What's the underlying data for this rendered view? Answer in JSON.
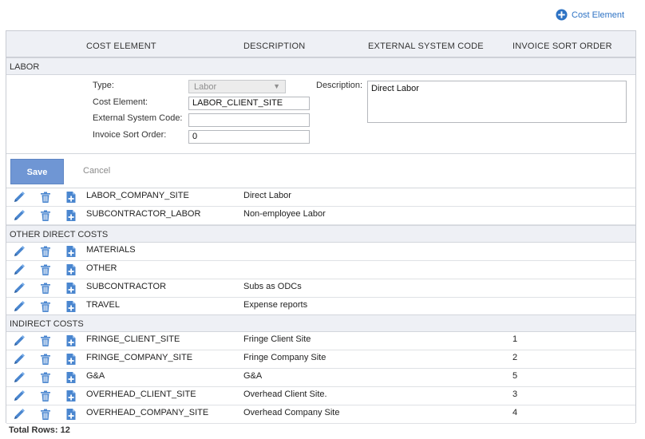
{
  "toolbar": {
    "add_label": "Cost Element"
  },
  "columns": {
    "cost_element": "COST ELEMENT",
    "description": "DESCRIPTION",
    "external_code": "EXTERNAL SYSTEM CODE",
    "sort_order": "INVOICE SORT ORDER"
  },
  "groups": {
    "labor": "LABOR",
    "odc": "OTHER DIRECT COSTS",
    "indirect": "INDIRECT COSTS"
  },
  "editor": {
    "type_label": "Type:",
    "type_value": "Labor",
    "cost_element_label": "Cost Element:",
    "cost_element_value": "LABOR_CLIENT_SITE",
    "external_label": "External System Code:",
    "external_value": "",
    "sort_label": "Invoice Sort Order:",
    "sort_value": "0",
    "description_label": "Description:",
    "description_value": "Direct Labor",
    "save_label": "Save",
    "cancel_label": "Cancel"
  },
  "labor_rows": [
    {
      "name": "LABOR_COMPANY_SITE",
      "description": "Direct Labor",
      "code": "",
      "sort": ""
    },
    {
      "name": "SUBCONTRACTOR_LABOR",
      "description": "Non-employee Labor",
      "code": "",
      "sort": ""
    }
  ],
  "odc_rows": [
    {
      "name": "MATERIALS",
      "description": "",
      "code": "",
      "sort": ""
    },
    {
      "name": "OTHER",
      "description": "",
      "code": "",
      "sort": ""
    },
    {
      "name": "SUBCONTRACTOR",
      "description": "Subs as ODCs",
      "code": "",
      "sort": ""
    },
    {
      "name": "TRAVEL",
      "description": "Expense reports",
      "code": "",
      "sort": ""
    }
  ],
  "indirect_rows": [
    {
      "name": "FRINGE_CLIENT_SITE",
      "description": "Fringe Client Site",
      "code": "",
      "sort": "1"
    },
    {
      "name": "FRINGE_COMPANY_SITE",
      "description": "Fringe Company Site",
      "code": "",
      "sort": "2"
    },
    {
      "name": "G&A",
      "description": "G&A",
      "code": "",
      "sort": "5"
    },
    {
      "name": "OVERHEAD_CLIENT_SITE",
      "description": "Overhead Client Site.",
      "code": "",
      "sort": "3"
    },
    {
      "name": "OVERHEAD_COMPANY_SITE",
      "description": "Overhead Company Site",
      "code": "",
      "sort": "4"
    }
  ],
  "footer": {
    "total_label": "Total Rows: 12"
  },
  "colors": {
    "accent": "#2e73c4",
    "save_button": "#6f96d4",
    "header_bg": "#eef0f5"
  },
  "icons": {
    "edit": "pencil-icon",
    "delete": "trash-icon",
    "copy": "copy-add-icon",
    "add": "plus-circle-icon"
  }
}
